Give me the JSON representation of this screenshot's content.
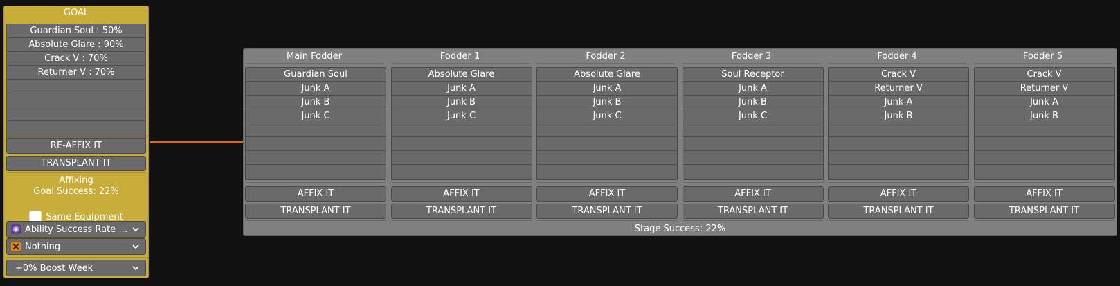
{
  "goal": {
    "title": "GOAL",
    "slots": [
      "Guardian Soul : 50%",
      "Absolute Glare : 90%",
      "Crack V : 70%",
      "Returner V : 70%",
      "",
      "",
      "",
      ""
    ],
    "reaffix_label": "RE-AFFIX IT",
    "transplant_label": "TRANSPLANT IT",
    "mode_label": "Affixing",
    "success_label": "Goal Success: 22%",
    "same_equipment_label": "Same Equipment",
    "same_equipment_checked": false,
    "ability_item": "Ability Success Rate +...",
    "potential_item": "Nothing",
    "boost_week": "+0% Boost Week"
  },
  "fodders": [
    {
      "header": "Main Fodder",
      "slots": [
        "Guardian Soul",
        "Junk A",
        "Junk B",
        "Junk C",
        "",
        "",
        "",
        ""
      ],
      "affix_label": "AFFIX IT",
      "transplant_label": "TRANSPLANT IT"
    },
    {
      "header": "Fodder 1",
      "slots": [
        "Absolute Glare",
        "Junk A",
        "Junk B",
        "Junk C",
        "",
        "",
        "",
        ""
      ],
      "affix_label": "AFFIX IT",
      "transplant_label": "TRANSPLANT IT"
    },
    {
      "header": "Fodder 2",
      "slots": [
        "Absolute Glare",
        "Junk A",
        "Junk B",
        "Junk C",
        "",
        "",
        "",
        ""
      ],
      "affix_label": "AFFIX IT",
      "transplant_label": "TRANSPLANT IT"
    },
    {
      "header": "Fodder 3",
      "slots": [
        "Soul Receptor",
        "Junk A",
        "Junk B",
        "Junk C",
        "",
        "",
        "",
        ""
      ],
      "affix_label": "AFFIX IT",
      "transplant_label": "TRANSPLANT IT"
    },
    {
      "header": "Fodder 4",
      "slots": [
        "Crack V",
        "Returner V",
        "Junk A",
        "Junk B",
        "",
        "",
        "",
        ""
      ],
      "affix_label": "AFFIX IT",
      "transplant_label": "TRANSPLANT IT"
    },
    {
      "header": "Fodder 5",
      "slots": [
        "Crack V",
        "Returner V",
        "Junk A",
        "Junk B",
        "",
        "",
        "",
        ""
      ],
      "affix_label": "AFFIX IT",
      "transplant_label": "TRANSPLANT IT"
    }
  ],
  "stage_success": "Stage Success: 22%",
  "colors": {
    "goal_panel": "#c9ad3a",
    "fodder_panel": "#808080",
    "slot": "#6a6a6a",
    "connector": "#d4661f",
    "background": "#111111"
  },
  "icons": {
    "ability_item": "ability-boost-item-icon",
    "potential_item": "orange-diamond-item-icon",
    "dropdown": "chevron-down-icon"
  }
}
